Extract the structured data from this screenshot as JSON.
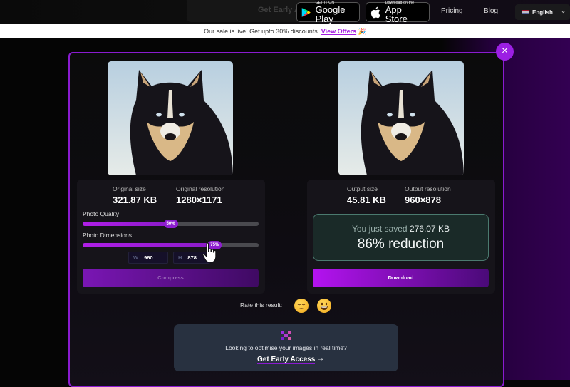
{
  "topbar": {
    "cta_partial": "Get Early Access",
    "google_play": {
      "small": "GET IT ON",
      "big": "Google Play"
    },
    "app_store": {
      "small": "Download on the",
      "big": "App Store"
    },
    "nav": [
      {
        "label": "Pricing"
      },
      {
        "label": "Blog"
      }
    ],
    "language": {
      "label": "English",
      "icon": "uk-flag-icon"
    }
  },
  "sale_bar": {
    "text": "Our sale is live! Get upto 30% discounts.",
    "link": "View Offers",
    "emoji": "🎉"
  },
  "modal": {
    "close_icon": "×",
    "original": {
      "size_label": "Original size",
      "size_value": "321.87 KB",
      "res_label": "Original resolution",
      "res_value": "1280×1171",
      "quality_label": "Photo Quality",
      "quality_percent": 50,
      "quality_text": "50%",
      "dimensions_label": "Photo Dimensions",
      "dimensions_percent": 75,
      "dimensions_text": "75%",
      "width_key": "W",
      "width_value": "960",
      "height_key": "H",
      "height_value": "878",
      "compress_label": "Compress"
    },
    "output": {
      "size_label": "Output size",
      "size_value": "45.81 KB",
      "res_label": "Output resolution",
      "res_value": "960×878",
      "saved_prefix": "You just saved",
      "saved_value": "276.07 KB",
      "reduction_text": "86% reduction",
      "download_label": "Download"
    },
    "rating": {
      "label": "Rate this result:",
      "options": [
        {
          "icon": "sad-face-icon"
        },
        {
          "icon": "grinning-face-icon"
        }
      ]
    },
    "cta": {
      "text": "Looking to optimise your images in real time?",
      "link": "Get Early Access",
      "arrow": "→"
    }
  },
  "colors": {
    "accent": "#9c1fe3",
    "saved_box_border": "#4b7a6f",
    "cta_card": "#283140"
  }
}
